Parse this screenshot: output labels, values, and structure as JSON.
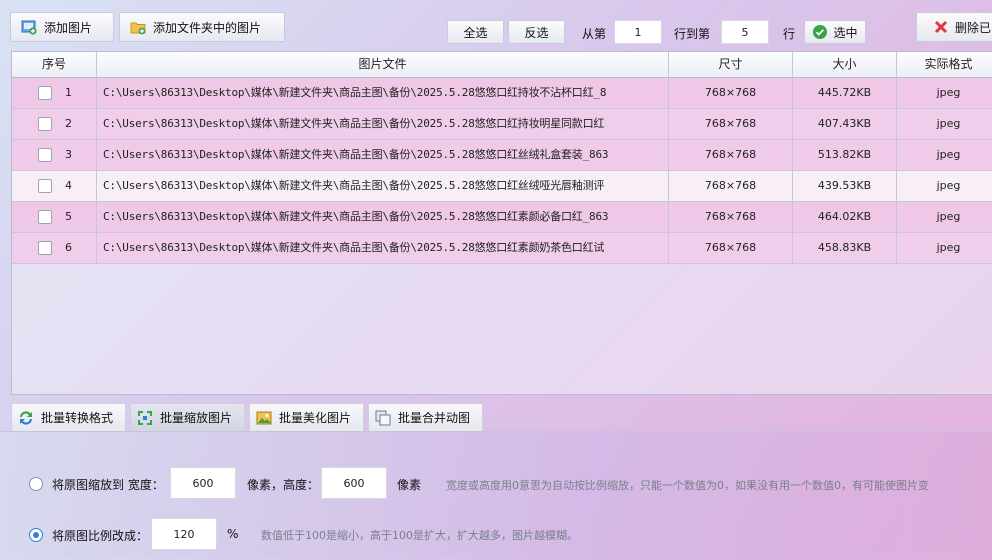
{
  "toolbar": {
    "add_image": "添加图片",
    "add_folder_images": "添加文件夹中的图片",
    "select_all": "全选",
    "invert": "反选",
    "from_row": "从第",
    "from_value": "1",
    "to_row": "行到第",
    "to_value": "5",
    "row_unit": "行",
    "select": "选中",
    "delete": "删除已"
  },
  "table": {
    "headers": [
      "序号",
      "图片文件",
      "尺寸",
      "大小",
      "实际格式"
    ],
    "rows": [
      {
        "idx": "1",
        "file": "C:\\Users\\86313\\Desktop\\媒体\\新建文件夹\\商品主图\\备份\\2025.5.28悠悠口红持妆不沾杯口红_8",
        "size": "768×768",
        "bytes": "445.72KB",
        "format": "jpeg"
      },
      {
        "idx": "2",
        "file": "C:\\Users\\86313\\Desktop\\媒体\\新建文件夹\\商品主图\\备份\\2025.5.28悠悠口红持妆明星同款口红",
        "size": "768×768",
        "bytes": "407.43KB",
        "format": "jpeg"
      },
      {
        "idx": "3",
        "file": "C:\\Users\\86313\\Desktop\\媒体\\新建文件夹\\商品主图\\备份\\2025.5.28悠悠口红丝绒礼盒套装_863",
        "size": "768×768",
        "bytes": "513.82KB",
        "format": "jpeg"
      },
      {
        "idx": "4",
        "file": "C:\\Users\\86313\\Desktop\\媒体\\新建文件夹\\商品主图\\备份\\2025.5.28悠悠口红丝绒哑光唇釉测评",
        "size": "768×768",
        "bytes": "439.53KB",
        "format": "jpeg"
      },
      {
        "idx": "5",
        "file": "C:\\Users\\86313\\Desktop\\媒体\\新建文件夹\\商品主图\\备份\\2025.5.28悠悠口红素颜必备口红_863",
        "size": "768×768",
        "bytes": "464.02KB",
        "format": "jpeg"
      },
      {
        "idx": "6",
        "file": "C:\\Users\\86313\\Desktop\\媒体\\新建文件夹\\商品主图\\备份\\2025.5.28悠悠口红素颜奶茶色口红试",
        "size": "768×768",
        "bytes": "458.83KB",
        "format": "jpeg"
      }
    ]
  },
  "tabs": [
    "批量转换格式",
    "批量缩放图片",
    "批量美化图片",
    "批量合并动图"
  ],
  "active_tab": "批量缩放图片",
  "scale_panel": {
    "option1_label": "将原图缩放到 宽度：",
    "width_value": "600",
    "pixels_height": "像素，高度：",
    "height_value": "600",
    "pixels": "像素",
    "option1_hint": "宽度或高度用0意思为自动按比例缩放，只能一个数值为0，如果没有用一个数值0，有可能使图片变",
    "option2_label": "将原图比例改成：",
    "ratio_value": "120",
    "percent": "%",
    "option2_hint": "数值低于100是缩小，高于100是扩大，扩大越多，图片越模糊。",
    "selected_option": 2
  },
  "colors": {
    "accent_blue": "#2f7fd6",
    "delete_red": "#e0383e",
    "check_green": "#3aa34a"
  }
}
